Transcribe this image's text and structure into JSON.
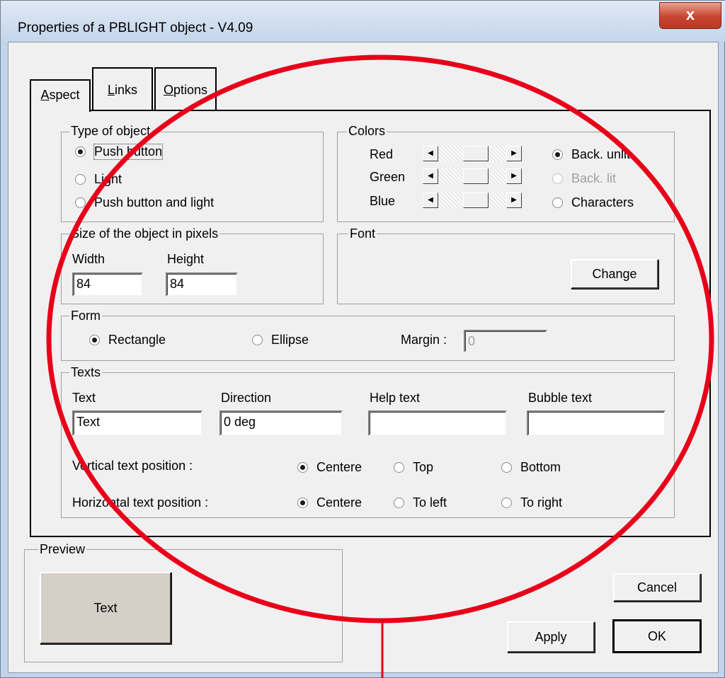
{
  "window": {
    "title": "Properties of a PBLIGHT object - V4.09",
    "close_glyph": "x"
  },
  "tabs": [
    {
      "label": "Aspect",
      "mnemonic": "A",
      "rest": "spect",
      "active": true
    },
    {
      "label": "Links",
      "mnemonic": "L",
      "rest": "inks",
      "active": false
    },
    {
      "label": "Options",
      "mnemonic": "O",
      "rest": "ptions",
      "active": false
    }
  ],
  "type_of_object": {
    "legend": "Type of object",
    "options": [
      {
        "label": "Push button",
        "checked": true
      },
      {
        "label": "Light",
        "checked": false
      },
      {
        "label": "Push button and light",
        "checked": false
      }
    ]
  },
  "colors": {
    "legend": "Colors",
    "channels": [
      {
        "label": "Red",
        "value_fraction": 0.58
      },
      {
        "label": "Green",
        "value_fraction": 0.58
      },
      {
        "label": "Blue",
        "value_fraction": 0.58
      }
    ],
    "targets": [
      {
        "label": "Back. unlit",
        "checked": true,
        "disabled": false
      },
      {
        "label": "Back. lit",
        "checked": false,
        "disabled": true
      },
      {
        "label": "Characters",
        "checked": false,
        "disabled": false
      }
    ],
    "arrow_left": "◀",
    "arrow_right": "▶"
  },
  "size": {
    "legend": "Size of the object in pixels",
    "width_label": "Width",
    "width_value": "84",
    "height_label": "Height",
    "height_value": "84"
  },
  "font": {
    "legend": "Font",
    "change_label": "Change"
  },
  "form": {
    "legend": "Form",
    "options": [
      {
        "label": "Rectangle",
        "checked": true
      },
      {
        "label": "Ellipse",
        "checked": false
      }
    ],
    "margin_label": "Margin :",
    "margin_value": "0"
  },
  "texts": {
    "legend": "Texts",
    "text_label": "Text",
    "text_value": "Text",
    "direction_label": "Direction",
    "direction_value": "0 deg",
    "help_label": "Help text",
    "help_value": "",
    "bubble_label": "Bubble text",
    "bubble_value": "",
    "vertical_label": "Vertical text position :",
    "vertical_options": [
      {
        "label": "Centere",
        "checked": true
      },
      {
        "label": "Top",
        "checked": false
      },
      {
        "label": "Bottom",
        "checked": false
      }
    ],
    "horizontal_label": "Horizontal text position :",
    "horizontal_options": [
      {
        "label": "Centere",
        "checked": true
      },
      {
        "label": "To left",
        "checked": false
      },
      {
        "label": "To right",
        "checked": false
      }
    ]
  },
  "preview": {
    "legend": "Preview",
    "button_text": "Text",
    "button_color": "#d4d0c8"
  },
  "buttons": {
    "cancel": "Cancel",
    "apply": "Apply",
    "ok": "OK"
  },
  "annotation": {
    "color": "#e8001a"
  }
}
